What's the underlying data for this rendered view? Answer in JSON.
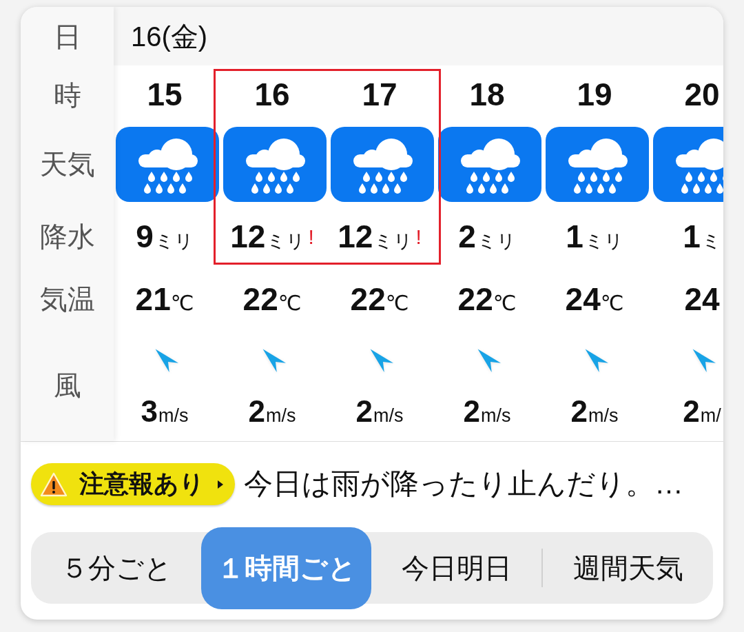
{
  "labels": {
    "day": "日",
    "hour": "時",
    "weather": "天気",
    "precipitation": "降水",
    "temperature": "気温",
    "wind": "風"
  },
  "date": "16(金)",
  "hours": [
    {
      "hour": "15",
      "precipitation": {
        "value": "9",
        "unit": "ミリ"
      },
      "temperature": {
        "value": "21",
        "unit": "℃"
      },
      "wind": {
        "speed": "3",
        "unit": "m/s"
      },
      "highlighted": false
    },
    {
      "hour": "16",
      "precipitation": {
        "value": "12",
        "unit": "ミリ",
        "alert": "!"
      },
      "temperature": {
        "value": "22",
        "unit": "℃"
      },
      "wind": {
        "speed": "2",
        "unit": "m/s"
      },
      "highlighted": true
    },
    {
      "hour": "17",
      "precipitation": {
        "value": "12",
        "unit": "ミリ",
        "alert": "!"
      },
      "temperature": {
        "value": "22",
        "unit": "℃"
      },
      "wind": {
        "speed": "2",
        "unit": "m/s"
      },
      "highlighted": true
    },
    {
      "hour": "18",
      "precipitation": {
        "value": "2",
        "unit": "ミリ"
      },
      "temperature": {
        "value": "22",
        "unit": "℃"
      },
      "wind": {
        "speed": "2",
        "unit": "m/s"
      },
      "highlighted": false
    },
    {
      "hour": "19",
      "precipitation": {
        "value": "1",
        "unit": "ミリ"
      },
      "temperature": {
        "value": "24",
        "unit": "℃"
      },
      "wind": {
        "speed": "2",
        "unit": "m/s"
      },
      "highlighted": false
    },
    {
      "hour": "20",
      "precipitation": {
        "value": "1",
        "unit": "ミ"
      },
      "temperature": {
        "value": "24"
      },
      "wind": {
        "speed": "2",
        "unit": "m/"
      },
      "highlighted": false
    }
  ],
  "advisory": {
    "label": "注意報あり"
  },
  "summary": "今日は雨が降ったり止んだり。…",
  "tabs": [
    {
      "label": "５分ごと",
      "selected": false
    },
    {
      "label": "１時間ごと",
      "selected": true
    },
    {
      "label": "今日明日",
      "selected": false
    },
    {
      "label": "週間天気",
      "selected": false
    }
  ]
}
